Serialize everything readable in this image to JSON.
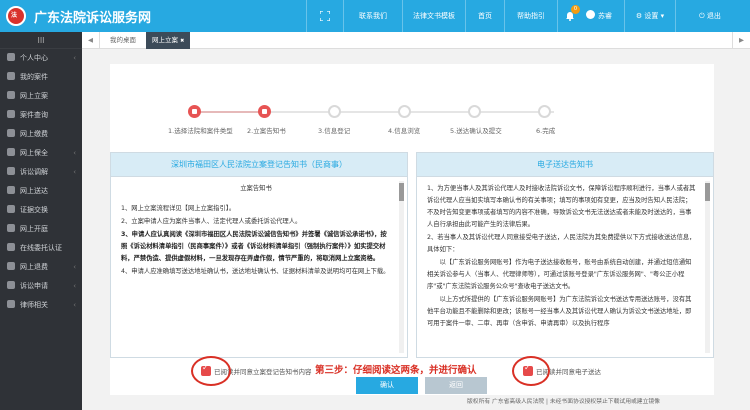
{
  "header": {
    "logo_text": "法",
    "app_title": "广东法院诉讼服务网",
    "contact": "联系我们",
    "templates": "法律文书模板",
    "home": "首页",
    "help": "帮助指引",
    "badge_count": "0",
    "user": "苏睿",
    "settings": "设置",
    "logout": "退出"
  },
  "sidebar": {
    "toggle": "III",
    "items": [
      {
        "label": "个人中心",
        "chevron": "‹"
      },
      {
        "label": "我的案件",
        "chevron": ""
      },
      {
        "label": "网上立案",
        "chevron": ""
      },
      {
        "label": "案件查询",
        "chevron": ""
      },
      {
        "label": "网上缴费",
        "chevron": ""
      },
      {
        "label": "网上保全",
        "chevron": "‹"
      },
      {
        "label": "诉讼调解",
        "chevron": "‹"
      },
      {
        "label": "网上送达",
        "chevron": ""
      },
      {
        "label": "证据交换",
        "chevron": ""
      },
      {
        "label": "网上开庭",
        "chevron": ""
      },
      {
        "label": "在线委托认证",
        "chevron": ""
      },
      {
        "label": "网上退费",
        "chevron": "‹"
      },
      {
        "label": "诉讼申请",
        "chevron": "‹"
      },
      {
        "label": "律师相关",
        "chevron": "‹"
      }
    ]
  },
  "tabs": {
    "back": "◀",
    "desk": "我的桌面",
    "active": "网上立案",
    "close": "✖",
    "forward": "▶"
  },
  "steps": [
    "1.选择法院和案件类型",
    "2.立案告知书",
    "3.信息登记",
    "4.信息浏览",
    "5.送达确认及提交",
    "6.完成"
  ],
  "left_panel": {
    "title": "深圳市福田区人民法院立案登记告知书（民商事）",
    "doc_title": "立案告知书",
    "paragraphs": [
      "1、网上立案流程详见【网上立案指引】。",
      "2、立案申请人应为案件当事人、法定代理人或委托诉讼代理人。",
      "3、申请人应认真阅读《深圳市福田区人民法院诉讼诚信告知书》并签署《诚信诉讼承诺书》，按照《诉讼材料清单指引（民商事案件）》或者《诉讼材料清单指引（强制执行案件）》如实提交材料，严禁伪造、提供虚假材料，一旦发现存在弄虚作假，情节严重的，将取消网上立案资格。",
      "4、申请人应准确填写送达地址确认书，送达地址确认书、证据材料清单及说明均可在网上下载。"
    ]
  },
  "right_panel": {
    "title": "电子送达告知书",
    "paragraphs": [
      "1、为方便当事人及其诉讼代理人及时接收法院诉讼文书，保障诉讼程序顺利进行，当事人或者其诉讼代理人应当如实填写本确认书的有关事项；填写的事项如有变更，应当及时告知人民法院；不及时告知变更事项或者填写的内容不准确，导致诉讼文书无法送达或者未能及时送达的，当事人自行承担由此可能产生的法律后果。",
      "2、若当事人及其诉讼代理人同意接受电子送达，人民法院为其免费提供以下方式接收送达信息，具体如下：",
      "　　以【广东诉讼服务网账号】作为电子送达接收账号，账号由系统自动创建，并通过短信通知相关诉讼参与人（当事人、代理律师等），可通过该账号登录\"广东诉讼服务网\"、\"粤公正小程序\"或\"广东法院诉讼服务公众号\"查收电子送达文书。",
      "　　以上方式所提供的【广东诉讼服务网账号】为广东法院诉讼文书送达专用送达账号，没有其他平台功能且不能删除和更改；该账号一经当事人及其诉讼代理人确认为诉讼文书送达地址，即可用于案件一审、二审、再审（含申诉、申请再审）以及执行程序"
    ]
  },
  "consent": {
    "left_label": "已阅读并同意立案登记告知书内容",
    "right_label": "已阅读并同意电子送达"
  },
  "annotation": "第三步：仔细阅读这两条，并进行确认",
  "buttons": {
    "confirm": "确认",
    "back": "返回"
  },
  "footer": "版权所有 广东省高级人民法院 | 未经书面协议授权禁止下载试用或建立镜像",
  "colors": {
    "primary": "#27a9e1",
    "sidebar_bg": "#2f3237",
    "step_active": "#e75454",
    "annotation": "#d93025",
    "back_button": "#b8c7d1"
  },
  "icons": [
    "logo-icon",
    "fullscreen-icon",
    "contact-icon",
    "document-icon",
    "home-icon",
    "help-icon",
    "bell-icon",
    "avatar-icon",
    "gear-icon",
    "logout-icon"
  ]
}
